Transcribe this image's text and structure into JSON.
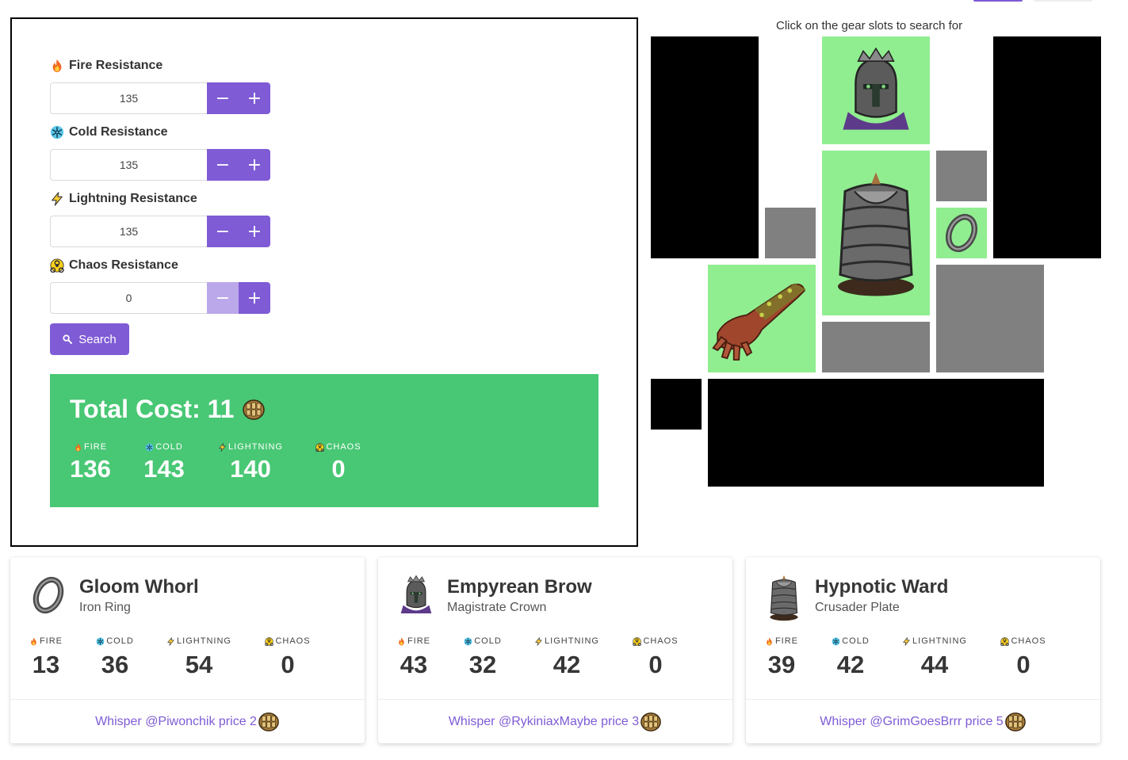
{
  "form": {
    "fields": [
      {
        "label": "Fire Resistance",
        "value": "135",
        "icon": "fire-icon"
      },
      {
        "label": "Cold Resistance",
        "value": "135",
        "icon": "snowflake-icon"
      },
      {
        "label": "Lightning Resistance",
        "value": "135",
        "icon": "lightning-icon"
      },
      {
        "label": "Chaos Resistance",
        "value": "0",
        "icon": "biohazard-icon"
      }
    ],
    "minus_glyph": "−",
    "plus_glyph": "+",
    "search_label": "Search"
  },
  "total": {
    "title": "Total Cost: 11",
    "stats": [
      {
        "label": "FIRE",
        "value": "136"
      },
      {
        "label": "COLD",
        "value": "143"
      },
      {
        "label": "LIGHTNING",
        "value": "140"
      },
      {
        "label": "CHAOS",
        "value": "0"
      }
    ]
  },
  "gear": {
    "caption": "Click on the gear slots to search for",
    "slot_color_selected": "#90ee90",
    "slot_color_empty": "#808080",
    "slot_color_locked": "#000000"
  },
  "items": [
    {
      "name": "Gloom Whorl",
      "base": "Iron Ring",
      "icon": "ring-icon",
      "stats": [
        {
          "label": "FIRE",
          "value": "13"
        },
        {
          "label": "COLD",
          "value": "36"
        },
        {
          "label": "LIGHTNING",
          "value": "54"
        },
        {
          "label": "CHAOS",
          "value": "0"
        }
      ],
      "whisper": "Whisper @Piwonchik price 2"
    },
    {
      "name": "Empyrean Brow",
      "base": "Magistrate Crown",
      "icon": "helmet-icon",
      "stats": [
        {
          "label": "FIRE",
          "value": "43"
        },
        {
          "label": "COLD",
          "value": "32"
        },
        {
          "label": "LIGHTNING",
          "value": "42"
        },
        {
          "label": "CHAOS",
          "value": "0"
        }
      ],
      "whisper": "Whisper @RykiniaxMaybe price 3"
    },
    {
      "name": "Hypnotic Ward",
      "base": "Crusader Plate",
      "icon": "body-armour-icon",
      "stats": [
        {
          "label": "FIRE",
          "value": "39"
        },
        {
          "label": "COLD",
          "value": "42"
        },
        {
          "label": "LIGHTNING",
          "value": "44"
        },
        {
          "label": "CHAOS",
          "value": "0"
        }
      ],
      "whisper": "Whisper @GrimGoesBrrr price 5"
    }
  ],
  "colors": {
    "accent": "#7f5bd5",
    "success": "#48c774",
    "link": "#7f5bd5"
  }
}
